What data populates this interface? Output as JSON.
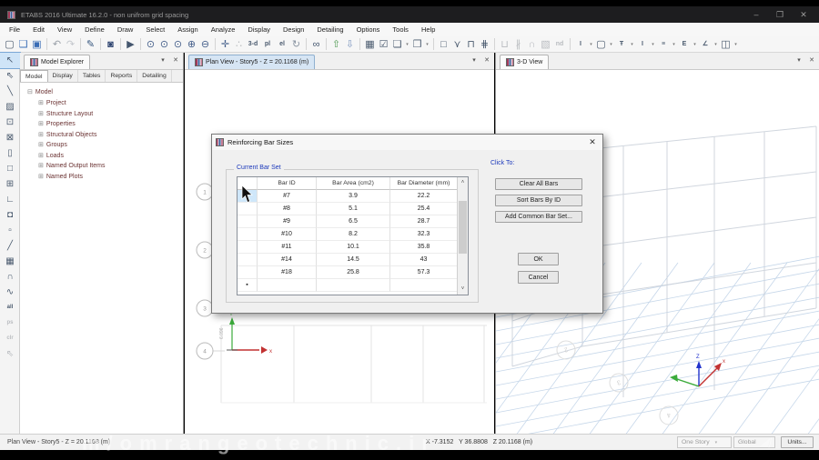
{
  "window": {
    "title": "ETABS 2016 Ultimate 16.2.0 - non unifrom grid spacing",
    "minimize": "–",
    "maximize": "❐",
    "close": "✕"
  },
  "menu": {
    "items": [
      "File",
      "Edit",
      "View",
      "Define",
      "Draw",
      "Select",
      "Assign",
      "Analyze",
      "Display",
      "Design",
      "Detailing",
      "Options",
      "Tools",
      "Help"
    ]
  },
  "ui_glyphs": {
    "dropdown": "▾",
    "close": "✕",
    "scroll_up": "˄",
    "scroll_down": "˅",
    "tree_collapse": "⊟",
    "tree_expand": "⊞"
  },
  "toolbar": {
    "items": [
      {
        "name": "new-model",
        "g": "▢"
      },
      {
        "name": "open-model",
        "g": "❑",
        "c": "#3a6db5"
      },
      {
        "name": "save-model",
        "g": "▣",
        "c": "#3a6db5"
      },
      {
        "name": "sep"
      },
      {
        "name": "undo",
        "g": "↶",
        "c": "#9aa0a8"
      },
      {
        "name": "redo",
        "g": "↷",
        "c": "#c3c7cc"
      },
      {
        "name": "sep"
      },
      {
        "name": "edit-pencil",
        "g": "✎",
        "c": "#35557e"
      },
      {
        "name": "sep"
      },
      {
        "name": "lock-model",
        "g": "◙",
        "c": "#2e4470"
      },
      {
        "name": "sep"
      },
      {
        "name": "run-analysis",
        "g": "▶",
        "c": "#44566e"
      },
      {
        "name": "sep"
      },
      {
        "name": "rubber-band-zoom",
        "g": "⊙",
        "c": "#47618c"
      },
      {
        "name": "restore-full-view",
        "g": "⊙",
        "c": "#47618c"
      },
      {
        "name": "previous-zoom",
        "g": "⊙",
        "c": "#47618c"
      },
      {
        "name": "zoom-in",
        "g": "⊕",
        "c": "#47618c"
      },
      {
        "name": "zoom-out",
        "g": "⊖",
        "c": "#47618c"
      },
      {
        "name": "sep"
      },
      {
        "name": "pan",
        "g": "✛",
        "c": "#47618c"
      },
      {
        "name": "snap-dots",
        "g": "∴",
        "disabled": true
      },
      {
        "name": "view-3d",
        "t": "3-d"
      },
      {
        "name": "view-plan",
        "t": "pl"
      },
      {
        "name": "view-elevation",
        "t": "el"
      },
      {
        "name": "rotate-3d-view",
        "g": "↻",
        "c": "#8a94a2"
      },
      {
        "name": "sep"
      },
      {
        "name": "display-glasses",
        "g": "∞",
        "c": "#44566e"
      },
      {
        "name": "sep"
      },
      {
        "name": "move-up-in-list",
        "g": "⇧",
        "c": "#4f9a52"
      },
      {
        "name": "move-down-in-list",
        "g": "⇩",
        "c": "#7d96bf"
      },
      {
        "name": "sep"
      },
      {
        "name": "view-limits",
        "g": "▦"
      },
      {
        "name": "show-selection",
        "g": "☑"
      },
      {
        "name": "shrink-objects",
        "g": "❏",
        "dd": true
      },
      {
        "name": "object-view-options",
        "g": "❒",
        "dd": true
      },
      {
        "name": "sep"
      },
      {
        "name": "draw-rectangle",
        "g": "□"
      },
      {
        "name": "draw-special-joint",
        "g": "⋎"
      },
      {
        "name": "quick-draw-frame",
        "g": "⊓"
      },
      {
        "name": "quick-draw-secondary-beams",
        "g": "⋕"
      },
      {
        "name": "sep"
      },
      {
        "name": "draw-wall-stack",
        "g": "⊔",
        "disabled": true
      },
      {
        "name": "auto-draw",
        "g": "∦",
        "disabled": true
      },
      {
        "name": "draw-dome",
        "g": "∩",
        "disabled": true
      },
      {
        "name": "draw-gray-box",
        "g": "▧",
        "disabled": true
      },
      {
        "name": "nd-tool",
        "t": "nd",
        "disabled": true
      },
      {
        "name": "sep"
      },
      {
        "name": "steel-frame-design",
        "t": "I",
        "dd": true
      },
      {
        "name": "concrete-frame-design",
        "g": "▢",
        "dd": true
      },
      {
        "name": "composite-beam-design",
        "t": "Ŧ",
        "dd": true
      },
      {
        "name": "composite-column-design",
        "t": "I",
        "dd": true
      },
      {
        "name": "steel-joist-design",
        "t": "≡",
        "dd": true
      },
      {
        "name": "wall-design",
        "t": "E",
        "dd": true
      },
      {
        "name": "slab-design",
        "t": "∠",
        "dd": true
      },
      {
        "name": "detailing-tool",
        "g": "◫",
        "dd": true
      }
    ]
  },
  "left_toolbar": {
    "items": [
      {
        "name": "select-pointer",
        "g": "↖",
        "active": true
      },
      {
        "name": "reshape-object",
        "g": "⇖"
      },
      {
        "name": "draw-line",
        "g": "╲"
      },
      {
        "name": "draw-frame-region",
        "g": "▨"
      },
      {
        "name": "draw-braced-frame",
        "g": "⊡"
      },
      {
        "name": "draw-cross-brace",
        "g": "⊠"
      },
      {
        "name": "new-blank-area",
        "g": "▯"
      },
      {
        "name": "draw-rectangular-area",
        "g": "□"
      },
      {
        "name": "draw-area-with-points",
        "g": "⊞"
      },
      {
        "name": "draw-l-wall",
        "g": "∟"
      },
      {
        "name": "draw-wall-points",
        "g": "◘"
      },
      {
        "name": "draw-opening",
        "g": "▫"
      },
      {
        "name": "draw-link",
        "g": "╱"
      },
      {
        "name": "draw-mesh",
        "g": "▦"
      },
      {
        "name": "draw-dome",
        "g": "∩"
      },
      {
        "name": "draw-curve",
        "g": "∿"
      },
      {
        "name": "snap-all",
        "t": "all"
      },
      {
        "name": "snap-ps",
        "t": "ps",
        "disabled": true
      },
      {
        "name": "snap-clr",
        "t": "clr",
        "disabled": true
      },
      {
        "name": "snap-pointer",
        "g": "⇖",
        "disabled": true
      }
    ]
  },
  "model_explorer": {
    "title": "Model Explorer",
    "tabs": [
      "Model",
      "Display",
      "Tables",
      "Reports",
      "Detailing"
    ],
    "active_tab": "Model",
    "root": "Model",
    "items": [
      "Project",
      "Structure Layout",
      "Properties",
      "Structural Objects",
      "Groups",
      "Loads",
      "Named Output Items",
      "Named Plots"
    ]
  },
  "plan_view": {
    "tab_label": "Plan View - Story5 - Z = 20.1168 (m)",
    "grid_bubbles": [
      "1",
      "2",
      "3",
      "4"
    ],
    "dim_label": "6.096",
    "axis_x_label": "x",
    "axis_y_label": "Y"
  },
  "view_3d": {
    "tab_label": "3-D View",
    "grid_bubbles": [
      "2",
      "3",
      "4"
    ],
    "axis_z_label": "Z",
    "axis_x_label": "x"
  },
  "dialog": {
    "title": "Reinforcing Bar Sizes",
    "group_label": "Current Bar Set",
    "click_to_label": "Click To:",
    "clear_button": "Clear All Bars",
    "sort_button": "Sort Bars By ID",
    "add_button": "Add Common Bar Set...",
    "ok_button": "OK",
    "cancel_button": "Cancel",
    "table": {
      "headers": [
        "Bar ID",
        "Bar Area  (cm2)",
        "Bar Diameter  (mm)"
      ],
      "rows": [
        [
          "#7",
          "3.9",
          "22.2"
        ],
        [
          "#8",
          "5.1",
          "25.4"
        ],
        [
          "#9",
          "6.5",
          "28.7"
        ],
        [
          "#10",
          "8.2",
          "32.3"
        ],
        [
          "#11",
          "10.1",
          "35.8"
        ],
        [
          "#14",
          "14.5",
          "43"
        ],
        [
          "#18",
          "25.8",
          "57.3"
        ]
      ],
      "new_row_marker": "▪"
    }
  },
  "status_bar": {
    "left_text": "Plan View - Story5 - Z = 20.1168 (m)",
    "coords": "X -7.3152   Y 36.8808   Z 20.1168 (m)",
    "story_selector": "One Story",
    "reference_selector": "Global",
    "units_button": "Units...",
    "watermark": "m/omrangeotechnic.ir"
  }
}
